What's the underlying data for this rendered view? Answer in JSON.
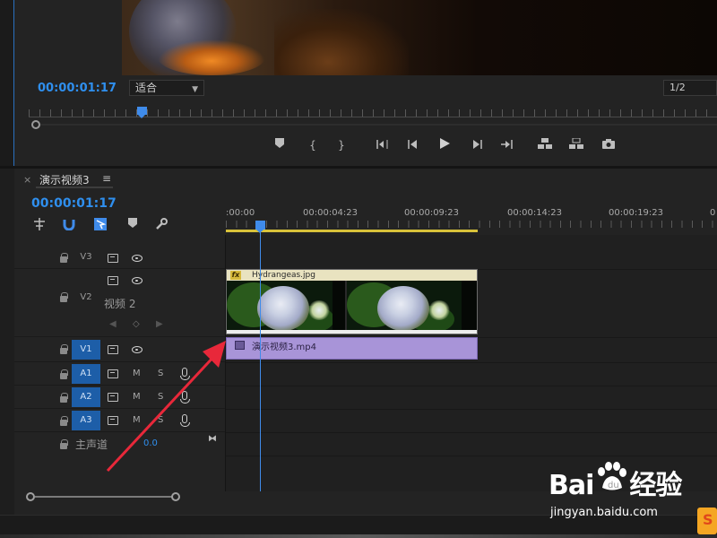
{
  "monitor": {
    "timecode": "00:00:01:17",
    "fit_label": "适合",
    "resolution": "1/2"
  },
  "transport": {
    "buttons": [
      "marker",
      "mark-in",
      "mark-out",
      "go-to-in",
      "step-back",
      "play",
      "step-forward",
      "go-to-out",
      "lift",
      "extract",
      "export-frame"
    ]
  },
  "timeline": {
    "tab_close": "×",
    "sequence_name": "演示视频3",
    "menu_icon": "≡",
    "timecode": "00:00:01:17",
    "ruler_labels": [
      ":00:00",
      "00:00:04:23",
      "00:00:09:23",
      "00:00:14:23",
      "00:00:19:23",
      "0"
    ],
    "tracks": {
      "v3": {
        "label": "V3"
      },
      "v2": {
        "label": "V2",
        "name": "视频 2"
      },
      "v1": {
        "label": "V1"
      },
      "a1": {
        "label": "A1",
        "m": "M",
        "s": "S"
      },
      "a2": {
        "label": "A2",
        "m": "M",
        "s": "S"
      },
      "a3": {
        "label": "A3",
        "m": "M",
        "s": "S"
      },
      "master": {
        "label": "主声道",
        "value": "0.0"
      }
    },
    "clips": {
      "v2_clip": {
        "fx": "fx",
        "name": "Hydrangeas.jpg"
      },
      "v1_clip": {
        "name": "演示视频3.mp4"
      }
    }
  },
  "watermark": {
    "logo_left": "Bai",
    "logo_right": "经验",
    "url": "jingyan.baidu.com"
  },
  "colors": {
    "accent_blue": "#2f8fee",
    "playhead": "#3f8bea",
    "work_area": "#d8c23a",
    "video_clip_header": "#e9e3c0",
    "audio_video_clip": "#a894d8",
    "annotation_arrow": "#e8283a"
  }
}
